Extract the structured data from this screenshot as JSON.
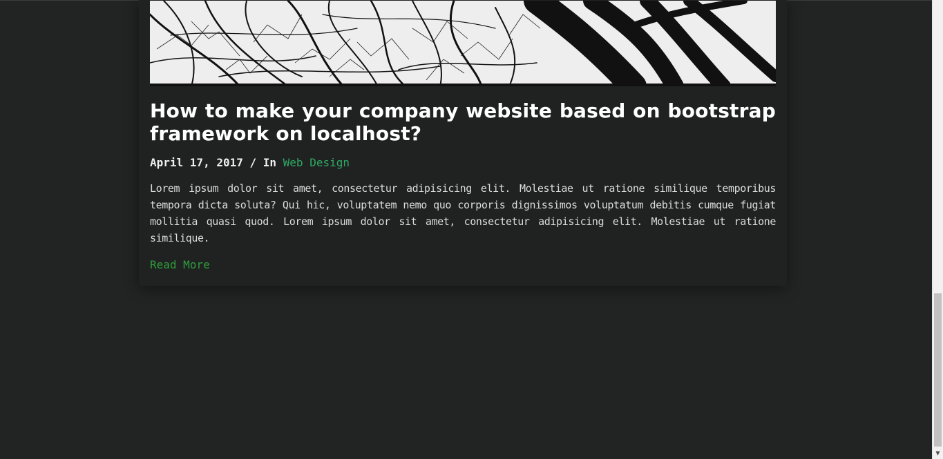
{
  "post": {
    "image_description_icon": "tree-branches-photo",
    "title": "How to make your company website based on bootstrap framework on localhost?",
    "date": "April 17, 2017",
    "separator": " / In ",
    "category": "Web Design",
    "excerpt": "Lorem ipsum dolor sit amet, consectetur adipisicing elit. Molestiae ut ratione similique temporibus tempora dicta soluta? Qui hic, voluptatem nemo quo corporis dignissimos voluptatum debitis cumque fugiat mollitia quasi quod. Lorem ipsum dolor sit amet, consectetur adipisicing elit. Molestiae ut ratione similique.",
    "read_more": "Read More"
  },
  "colors": {
    "background": "#222424",
    "card": "#202222",
    "accent_category": "#2faa63",
    "accent_link": "#2e9d3a",
    "text": "#ffffff"
  },
  "scrollbar": {
    "down_arrow_icon": "scroll-down-arrow-icon"
  }
}
